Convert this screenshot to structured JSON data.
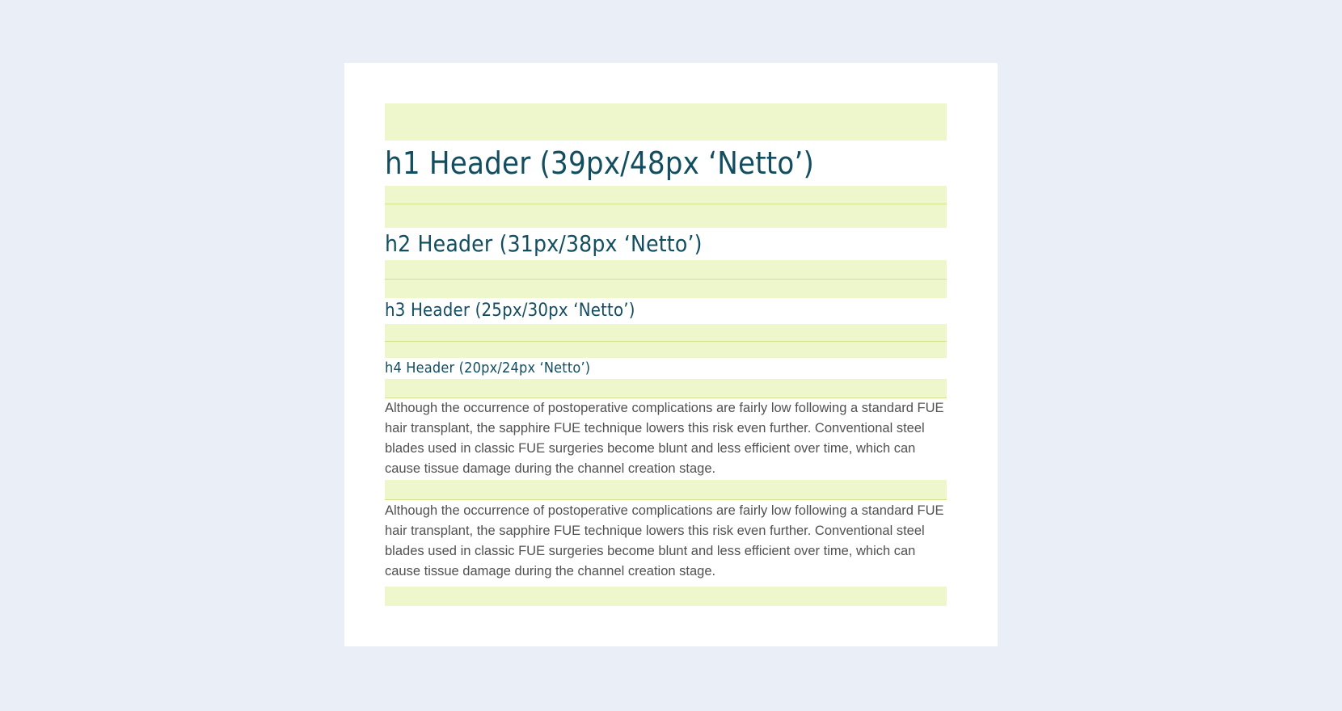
{
  "headers": {
    "h1": "h1 Header (39px/48px  ‘Netto’)",
    "h2": "h2 Header (31px/38px  ‘Netto’)",
    "h3": "h3 Header (25px/30px  ‘Netto’)",
    "h4": "h4 Header (20px/24px  ‘Netto’)"
  },
  "paragraphs": [
    "Although the occurrence of postoperative complications are fairly low following a standard FUE hair transplant, the sapphire FUE technique lowers this risk even further. Conventional steel blades used in classic FUE surgeries become blunt and less efficient over time, which can cause tissue damage during the channel creation stage.",
    "Although the occurrence of postoperative complications are fairly low following a standard FUE hair transplant, the sapphire FUE technique lowers this risk even further. Conventional steel blades used in classic FUE surgeries become blunt and less efficient over time, which can cause tissue damage during the channel creation stage."
  ],
  "colors": {
    "background": "#e9eef7",
    "card": "#ffffff",
    "spacing_band": "#eef6cc",
    "baseline_rule": "#cfe38d",
    "heading": "#134d60",
    "body_text": "#515151"
  }
}
